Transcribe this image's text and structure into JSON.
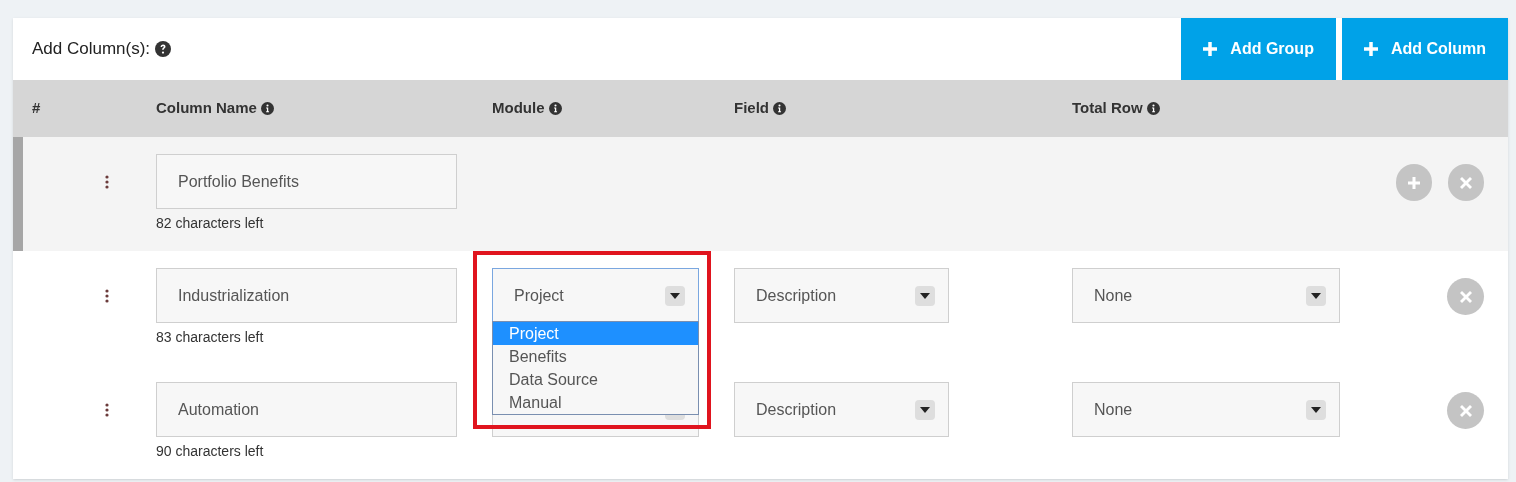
{
  "header": {
    "title": "Add Column(s):",
    "buttons": [
      {
        "label": "Add Group"
      },
      {
        "label": "Add Column"
      }
    ]
  },
  "columns": [
    {
      "label": "#",
      "kind": "plain"
    },
    {
      "label": "Column Name",
      "kind": "info"
    },
    {
      "label": "Module",
      "kind": "info"
    },
    {
      "label": "Field",
      "kind": "info"
    },
    {
      "label": "Total Row",
      "kind": "info"
    }
  ],
  "rows": [
    {
      "kind": "group",
      "name": "Portfolio Benefits",
      "counter": "82 characters left",
      "can_add": true
    },
    {
      "kind": "column",
      "name": "Industrialization",
      "counter": "83 characters left",
      "module": {
        "value": "Project",
        "open": true,
        "highlighted": true,
        "options": [
          {
            "label": "Project",
            "selected": true
          },
          {
            "label": "Benefits",
            "selected": false
          },
          {
            "label": "Data Source",
            "selected": false
          },
          {
            "label": "Manual",
            "selected": false
          }
        ]
      },
      "field": "Description",
      "total": "None"
    },
    {
      "kind": "column",
      "name": "Automation",
      "counter": "90 characters left",
      "module": {},
      "field": "Description",
      "total": "None"
    }
  ]
}
